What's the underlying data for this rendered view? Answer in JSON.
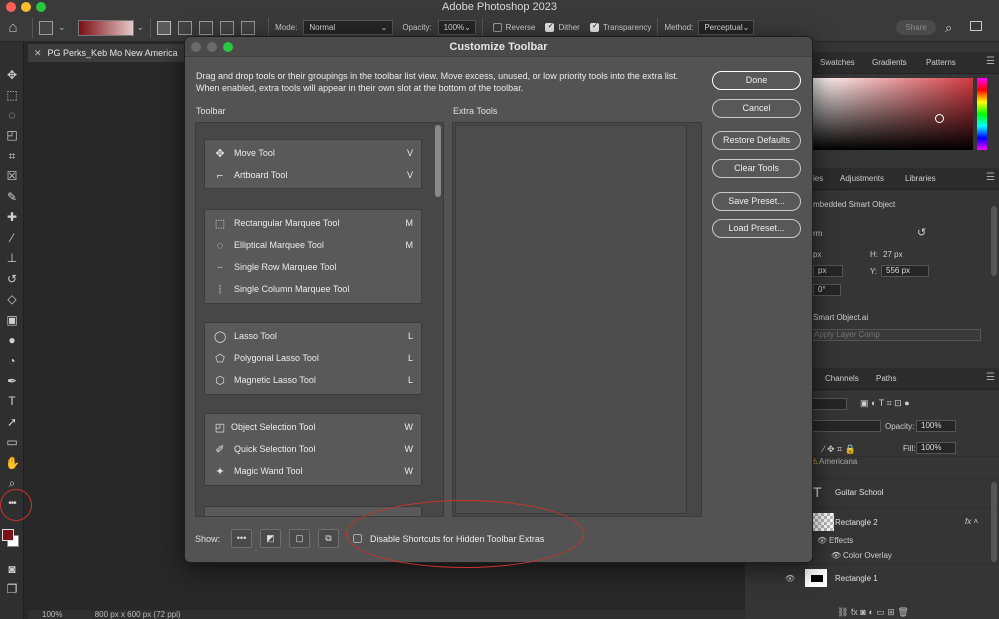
{
  "app": {
    "title": "Adobe Photoshop 2023",
    "traffic_lights": [
      "#ff5f57",
      "#febc2e",
      "#28c840"
    ]
  },
  "options_bar": {
    "mode_label": "Mode:",
    "mode_value": "Normal",
    "opacity_label": "Opacity:",
    "opacity_value": "100%",
    "reverse_label": "Reverse",
    "reverse_checked": false,
    "dither_label": "Dither",
    "dither_checked": true,
    "transparency_label": "Transparency",
    "transparency_checked": true,
    "method_label": "Method:",
    "method_value": "Perceptual",
    "share_label": "Share"
  },
  "document": {
    "tab_label": "PG Perks_Keb Mo New America",
    "zoom": "100%",
    "dims": "800 px x 600 px (72 ppi)"
  },
  "right_panels": {
    "top_tabs": [
      "Swatches",
      "Gradients",
      "Patterns"
    ],
    "mid_tabs": [
      "ies",
      "Adjustments",
      "Libraries"
    ],
    "props_title": "mbedded Smart Object",
    "transform_label": "rm",
    "w_value": "px",
    "h_label": "H:",
    "h_value": "27 px",
    "x_value": "px",
    "y_label": "Y:",
    "y_value": "556 px",
    "angle_value": "0°",
    "smart_object": "Smart Object.ai",
    "layer_comp": "Apply Layer Comp",
    "layer_tabs": [
      "Channels",
      "Paths"
    ],
    "opacity_label": "Opacity:",
    "opacity_value": "100%",
    "fill_label": "Fill:",
    "fill_value": "100%",
    "layers": {
      "partial_top": "Americana",
      "guitar_school": "Guitar School",
      "rect2": "Rectangle 2",
      "effects": "Effects",
      "color_overlay": "Color Overlay",
      "rect1": "Rectangle 1"
    }
  },
  "dialog": {
    "title": "Customize Toolbar",
    "description": "Drag and drop tools or their groupings in the toolbar list view. Move excess, unused, or low priority tools into the extra list. When enabled, extra tools will appear in their own slot at the bottom of the toolbar.",
    "toolbar_header": "Toolbar",
    "extra_header": "Extra Tools",
    "groups": [
      {
        "items": [
          {
            "name": "Move Tool",
            "shortcut": "V",
            "icon": "move-icon"
          },
          {
            "name": "Artboard Tool",
            "shortcut": "V",
            "icon": "artboard-icon"
          }
        ]
      },
      {
        "items": [
          {
            "name": "Rectangular Marquee Tool",
            "shortcut": "M",
            "icon": "rect-marquee-icon"
          },
          {
            "name": "Elliptical Marquee Tool",
            "shortcut": "M",
            "icon": "ellipse-marquee-icon"
          },
          {
            "name": "Single Row Marquee Tool",
            "shortcut": "",
            "icon": "row-marquee-icon"
          },
          {
            "name": "Single Column Marquee Tool",
            "shortcut": "",
            "icon": "column-marquee-icon"
          }
        ]
      },
      {
        "items": [
          {
            "name": "Lasso Tool",
            "shortcut": "L",
            "icon": "lasso-icon"
          },
          {
            "name": "Polygonal Lasso Tool",
            "shortcut": "L",
            "icon": "polygonal-lasso-icon"
          },
          {
            "name": "Magnetic Lasso Tool",
            "shortcut": "L",
            "icon": "magnetic-lasso-icon"
          }
        ]
      },
      {
        "items": [
          {
            "name": "Object Selection Tool",
            "shortcut": "W",
            "icon": "object-selection-icon"
          },
          {
            "name": "Quick Selection Tool",
            "shortcut": "W",
            "icon": "quick-selection-icon"
          },
          {
            "name": "Magic Wand Tool",
            "shortcut": "W",
            "icon": "magic-wand-icon"
          }
        ]
      }
    ],
    "buttons": {
      "done": "Done",
      "cancel": "Cancel",
      "restore": "Restore Defaults",
      "clear": "Clear Tools",
      "save_preset": "Save Preset...",
      "load_preset": "Load Preset..."
    },
    "show_label": "Show:",
    "show_buttons": [
      "•••",
      "◩",
      "▢",
      "⧉"
    ],
    "disable_shortcuts": "Disable Shortcuts for Hidden Toolbar Extras",
    "disable_checked": false
  },
  "annotation_color": "#c8332e"
}
